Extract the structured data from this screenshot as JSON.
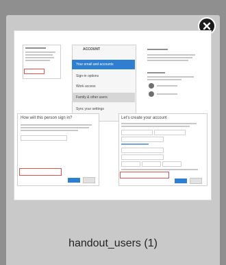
{
  "file": {
    "name": "handout_users (1)"
  },
  "thumbnail": {
    "middle_panel": {
      "header": "ACCOUNT",
      "menu": [
        "Your email and accounts",
        "Sign-in options",
        "Work access",
        "Family & other users",
        "Sync your settings"
      ]
    },
    "left_form_title": "How will this person sign in?",
    "right_form_title": "Let's create your account"
  },
  "icons": {
    "close": "close-icon"
  },
  "colors": {
    "background": "#8f8f8f",
    "card": "#c9c9c9",
    "accent": "#2f7fd1"
  }
}
